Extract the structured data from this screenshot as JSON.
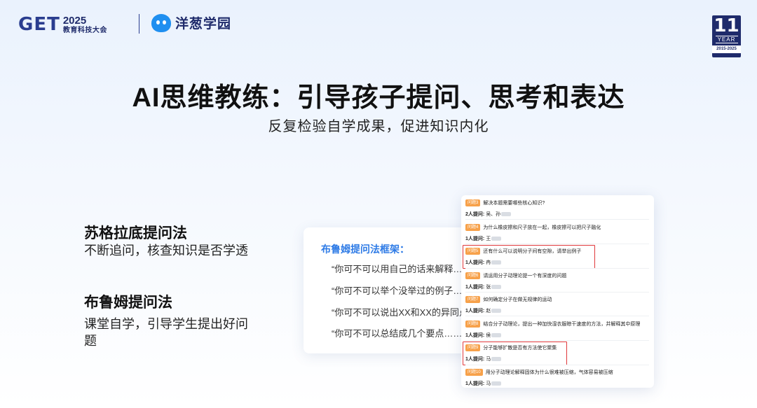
{
  "header": {
    "get_letters": "GET",
    "get_year": "2025",
    "get_subtitle": "教育科技大会",
    "partner_name": "洋葱学园",
    "badge": {
      "number": "11",
      "label": "YEAR",
      "range": "2015-2025"
    }
  },
  "title": "AI思维教练：引导孩子提问、思考和表达",
  "subtitle": "反复检验自学成果，促进知识内化",
  "methods": [
    {
      "title": "苏格拉底提问法",
      "desc": "不断追问，核查知识是否学透"
    },
    {
      "title": "布鲁姆提问法",
      "desc": "课堂自学，引导学生提出好问题"
    }
  ],
  "bloom": {
    "title": "布鲁姆提问法框架：",
    "questions": [
      "“你可不可以用自己的话来解释……",
      "“你可不可以举个没举过的例子……",
      "“你可不可以说出XX和XX的异同点……",
      "“你可不可以总结成几个要点……"
    ]
  },
  "questions_panel": {
    "items": [
      {
        "tag": "问题3",
        "text": "解决本题需要哪些核心知识?",
        "count": "2人提问:",
        "names": "吴、孙",
        "highlight": false
      },
      {
        "tag": "问题4",
        "text": "为什么橡皮擦和尺子放在一起，橡皮擦可以把尺子融化",
        "count": "1人提问:",
        "names": "王",
        "highlight": false
      },
      {
        "tag": "问题5",
        "text": "还有什么可以说明分子间有空隙，请举出例子",
        "count": "1人提问:",
        "names": "冉",
        "highlight": true
      },
      {
        "tag": "问题6",
        "text": "请运用分子动理论提一个有深度的问题",
        "count": "1人提问:",
        "names": "张",
        "highlight": false
      },
      {
        "tag": "问题7",
        "text": "如何确定分子在做无规律的运动",
        "count": "1人提问:",
        "names": "赵",
        "highlight": false
      },
      {
        "tag": "问题8",
        "text": "结合分子动理论，提出一种加快湿衣服晾干速度的方法，并解释其中原理",
        "count": "1人提问:",
        "names": "侯",
        "highlight": false
      },
      {
        "tag": "问题9",
        "text": "分子能够扩散是否有方法使它聚集",
        "count": "1人提问:",
        "names": "马",
        "highlight": true
      },
      {
        "tag": "问题10",
        "text": "用分子动理论解释固体为什么很难被压缩，气体容易被压缩",
        "count": "1人提问:",
        "names": "马",
        "highlight": false
      }
    ]
  }
}
